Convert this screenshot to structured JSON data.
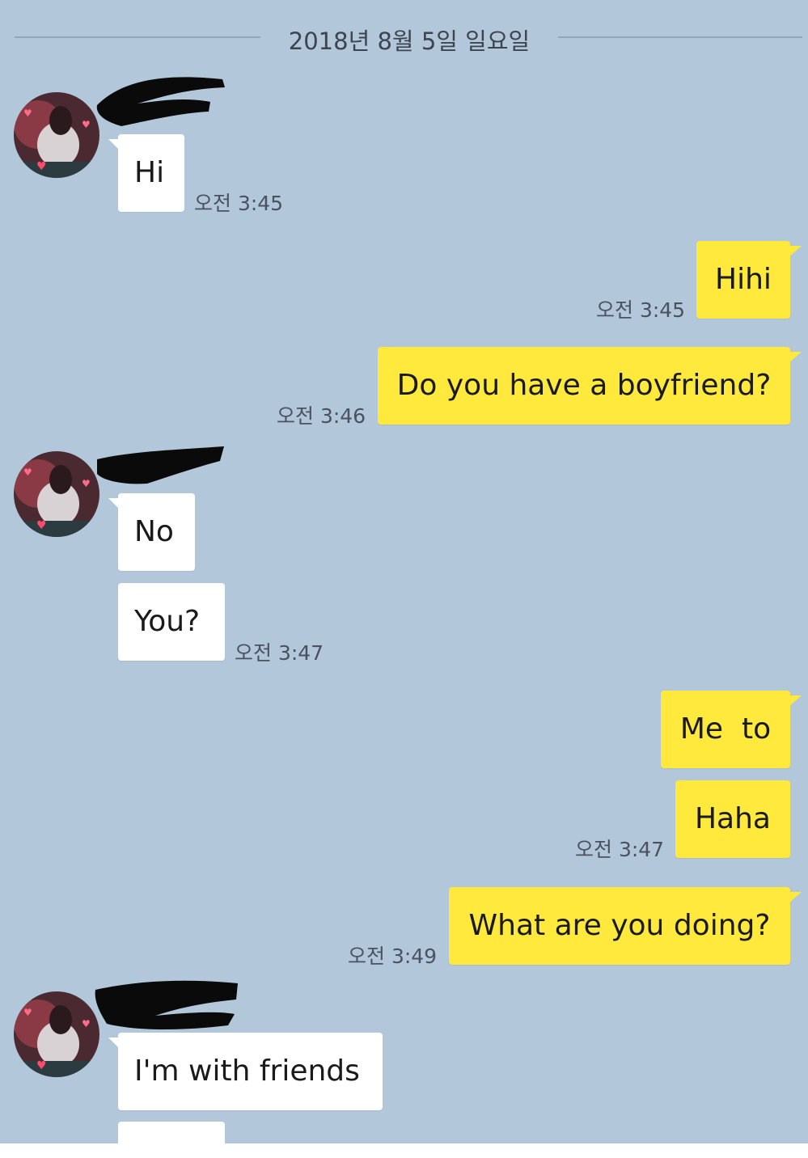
{
  "date_separator": "2018년 8월 5일 일요일",
  "messages": [
    {
      "side": "in",
      "text": "Hi",
      "time": "오전 3:45"
    },
    {
      "side": "out",
      "text": "Hihi",
      "time": "오전 3:45"
    },
    {
      "side": "out",
      "text": "Do you have a boyfriend?",
      "time": "오전 3:46"
    },
    {
      "side": "in",
      "text": "No",
      "time": ""
    },
    {
      "side": "in",
      "text": "You?",
      "time": "오전 3:47"
    },
    {
      "side": "out",
      "text": "Me  to",
      "time": ""
    },
    {
      "side": "out",
      "text": "Haha",
      "time": "오전 3:47"
    },
    {
      "side": "out",
      "text": "What are you doing?",
      "time": "오전 3:49"
    },
    {
      "side": "in",
      "text": "I'm with friends",
      "time": ""
    }
  ],
  "colors": {
    "chat_background": "#b2c7da",
    "outgoing_bubble": "#fee93c",
    "incoming_bubble": "#ffffff"
  }
}
